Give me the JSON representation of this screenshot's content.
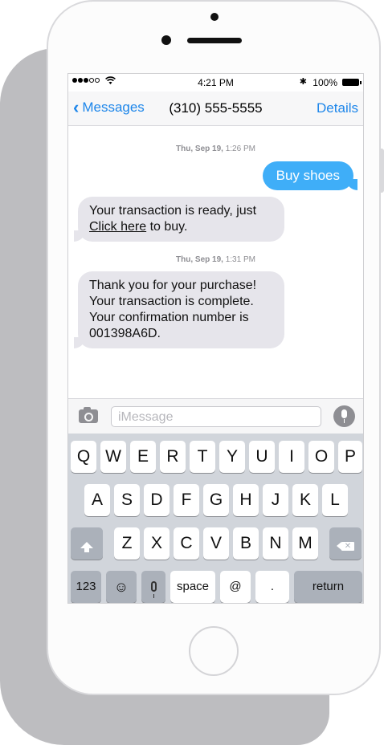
{
  "status": {
    "time": "4:21 PM",
    "bluetooth": "✱",
    "battery": "100%",
    "signal_bars": 5,
    "signal_filled": 3
  },
  "nav": {
    "back_label": "Messages",
    "title": "(310) 555-5555",
    "details_label": "Details",
    "back_icon": "chevron-left-icon"
  },
  "messages": {
    "ts1": {
      "day": "Thu, Sep 19,",
      "time": "1:26 PM"
    },
    "out1": "Buy shoes",
    "in1": {
      "line1": "Your transaction is ready, just",
      "link": "Click here",
      "rest": " to buy."
    },
    "ts2": {
      "day": "Thu, Sep 19,",
      "time": "1:31 PM"
    },
    "in2": [
      "Thank you for your purchase!",
      "Your transaction is complete.",
      "Your confirmation number is",
      "001398A6D."
    ]
  },
  "input": {
    "placeholder": "iMessage"
  },
  "keyboard": {
    "row1": [
      "Q",
      "W",
      "E",
      "R",
      "T",
      "Y",
      "U",
      "I",
      "O",
      "P"
    ],
    "row2": [
      "A",
      "S",
      "D",
      "F",
      "G",
      "H",
      "J",
      "K",
      "L"
    ],
    "row3": [
      "Z",
      "X",
      "C",
      "V",
      "B",
      "N",
      "M"
    ],
    "numbers": "123",
    "emoji": "☺",
    "space": "space",
    "at": "@",
    "dot": ".",
    "return": "return"
  },
  "colors": {
    "accent": "#1d86ea",
    "outgoing_bubble": "#3faef8",
    "incoming_bubble": "#e6e5eb"
  }
}
